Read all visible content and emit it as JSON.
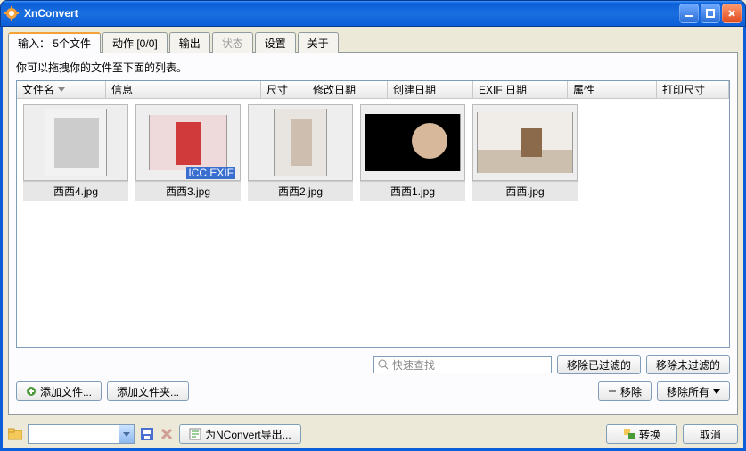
{
  "window": {
    "title": "XnConvert"
  },
  "tabs": {
    "input": "输入： 5个文件",
    "action": "动作 [0/0]",
    "output": "输出",
    "status": "状态",
    "settings": "设置",
    "about": "关于"
  },
  "hint": "你可以拖拽你的文件至下面的列表。",
  "columns": {
    "filename": "文件名",
    "info": "信息",
    "size": "尺寸",
    "mdate": "修改日期",
    "cdate": "创建日期",
    "exif": "EXIF 日期",
    "attr": "属性",
    "psize": "打印尺寸"
  },
  "files": [
    {
      "name": "西西4.jpg"
    },
    {
      "name": "西西3.jpg",
      "badges": "ICC EXIF"
    },
    {
      "name": "西西2.jpg"
    },
    {
      "name": "西西1.jpg"
    },
    {
      "name": "西西.jpg"
    }
  ],
  "search": {
    "placeholder": "快速查找"
  },
  "buttons": {
    "remove_filtered": "移除已过滤的",
    "remove_unfiltered": "移除未过滤的",
    "add_file": "添加文件...",
    "add_folder": "添加文件夹...",
    "remove": "移除",
    "remove_all": "移除所有",
    "export_nconvert": "为NConvert导出...",
    "convert": "转换",
    "cancel": "取消"
  }
}
